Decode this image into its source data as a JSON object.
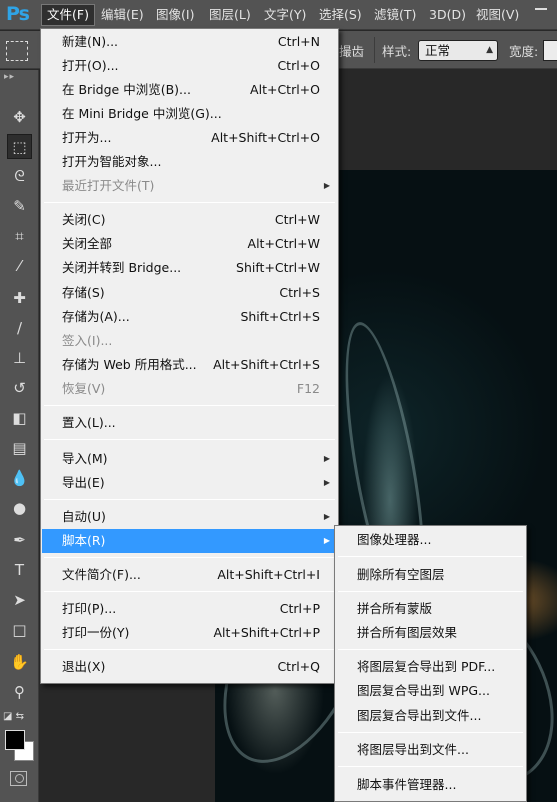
{
  "app": {
    "logo": "Ps"
  },
  "menubar": {
    "items": [
      {
        "label": "文件(F)"
      },
      {
        "label": "编辑(E)"
      },
      {
        "label": "图像(I)"
      },
      {
        "label": "图层(L)"
      },
      {
        "label": "文字(Y)"
      },
      {
        "label": "选择(S)"
      },
      {
        "label": "滤镜(T)"
      },
      {
        "label": "3D(D)"
      },
      {
        "label": "视图(V)"
      }
    ]
  },
  "options_bar": {
    "partial_label": "撮齿",
    "style_label": "样式:",
    "style_value": "正常",
    "width_label": "宽度:"
  },
  "file_menu": {
    "items": [
      {
        "label": "新建(N)...",
        "shortcut": "Ctrl+N"
      },
      {
        "label": "打开(O)...",
        "shortcut": "Ctrl+O"
      },
      {
        "label": "在 Bridge 中浏览(B)...",
        "shortcut": "Alt+Ctrl+O"
      },
      {
        "label": "在 Mini Bridge 中浏览(G)...",
        "shortcut": ""
      },
      {
        "label": "打开为...",
        "shortcut": "Alt+Shift+Ctrl+O"
      },
      {
        "label": "打开为智能对象...",
        "shortcut": ""
      },
      {
        "label": "最近打开文件(T)",
        "shortcut": ""
      },
      {
        "label": "关闭(C)",
        "shortcut": "Ctrl+W"
      },
      {
        "label": "关闭全部",
        "shortcut": "Alt+Ctrl+W"
      },
      {
        "label": "关闭并转到 Bridge...",
        "shortcut": "Shift+Ctrl+W"
      },
      {
        "label": "存储(S)",
        "shortcut": "Ctrl+S"
      },
      {
        "label": "存储为(A)...",
        "shortcut": "Shift+Ctrl+S"
      },
      {
        "label": "签入(I)...",
        "shortcut": ""
      },
      {
        "label": "存储为 Web 所用格式...",
        "shortcut": "Alt+Shift+Ctrl+S"
      },
      {
        "label": "恢复(V)",
        "shortcut": "F12"
      },
      {
        "label": "置入(L)...",
        "shortcut": ""
      },
      {
        "label": "导入(M)",
        "shortcut": ""
      },
      {
        "label": "导出(E)",
        "shortcut": ""
      },
      {
        "label": "自动(U)",
        "shortcut": ""
      },
      {
        "label": "脚本(R)",
        "shortcut": ""
      },
      {
        "label": "文件简介(F)...",
        "shortcut": "Alt+Shift+Ctrl+I"
      },
      {
        "label": "打印(P)...",
        "shortcut": "Ctrl+P"
      },
      {
        "label": "打印一份(Y)",
        "shortcut": "Alt+Shift+Ctrl+P"
      },
      {
        "label": "退出(X)",
        "shortcut": "Ctrl+Q"
      }
    ]
  },
  "script_menu": {
    "items": [
      {
        "label": "图像处理器..."
      },
      {
        "label": "删除所有空图层"
      },
      {
        "label": "拼合所有蒙版"
      },
      {
        "label": "拼合所有图层效果"
      },
      {
        "label": "将图层复合导出到 PDF..."
      },
      {
        "label": "图层复合导出到 WPG..."
      },
      {
        "label": "图层复合导出到文件..."
      },
      {
        "label": "将图层导出到文件..."
      },
      {
        "label": "脚本事件管理器..."
      }
    ]
  },
  "colors": {
    "highlight": "#3399ff",
    "menu_bg": "#f0f0f0",
    "chrome": "#535353",
    "logo": "#2fa4e7"
  }
}
